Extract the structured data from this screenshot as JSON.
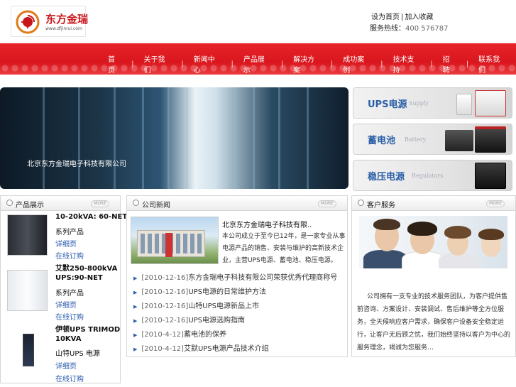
{
  "header": {
    "logo_text": "东方金瑞",
    "logo_url": "www.dfjinrui.com",
    "top_links": [
      "设为首页",
      "加入收藏"
    ],
    "hotline_label": "服务热线：",
    "hotline_number": "400 576787"
  },
  "nav": {
    "items": [
      "首页",
      "关于我们",
      "新闻中心",
      "产品展示",
      "解决方案",
      "成功案例",
      "技术支持",
      "招聘",
      "联系我们"
    ]
  },
  "banner": {
    "caption": "北京东方金瑞电子科技有限公司",
    "tiles": [
      {
        "cn": "UPS电源",
        "en": "Supply",
        "color": "#2a5fa8"
      },
      {
        "cn": "蓄电池",
        "en": "Battery",
        "color": "#2a5fa8"
      },
      {
        "cn": "稳压电源",
        "en": "Regulators",
        "color": "#2a5fa8"
      }
    ]
  },
  "products_panel": {
    "title": "产品展示",
    "more": "MORE",
    "products": [
      {
        "name_line1": "10-20kVA: 60-NET",
        "name_line2": "系列产品",
        "link1": "详细页",
        "link2": "在线订购"
      },
      {
        "name_line1": "艾默250-800kVA",
        "name_line2": "UPS:90-NET",
        "name_line3": "系列产品",
        "link1": "详细页",
        "link2": "在线订购"
      },
      {
        "name_line1": "伊顿UPS TRIMOD",
        "name_line2": "10KVA",
        "name_line3": "山特UPS 电源",
        "link1": "详细页",
        "link2": "在线订购"
      }
    ]
  },
  "news_panel": {
    "title": "公司新闻",
    "more": "MORE",
    "intro_title": "北京东方金瑞电子科技有限..",
    "intro_text": "本公司成立于至今已12年，是一家专业从事电源产品的销售、安装与维护的高新技术企业，主营UPS电源、蓄电池、稳压电源。",
    "items": [
      {
        "date": "[2010-12-16]",
        "title": "东方金瑞电子科技有限公司荣获优秀代理商称号"
      },
      {
        "date": "[2010-12-16]",
        "title": "UPS电源的日常维护方法"
      },
      {
        "date": "[2010-12-16]",
        "title": "山特UPS电源新品上市"
      },
      {
        "date": "[2010-12-16]",
        "title": "UPS电源选购指南"
      },
      {
        "date": "[2010-4-12]",
        "title": "蓄电池的保养"
      },
      {
        "date": "[2010-4-12]",
        "title": "艾默UPS电源产品技术介绍"
      }
    ]
  },
  "service_panel": {
    "title": "客户服务",
    "more": "MORE",
    "text": "公司拥有一支专业的技术服务团队，为客户提供售前咨询、方案设计、安装调试、售后维护等全方位服务，全天候响应客户需求，确保客户设备安全稳定运行，让客户无后顾之忧，我们始终坚持以客户为中心的服务理念，竭诚为您服务…"
  }
}
